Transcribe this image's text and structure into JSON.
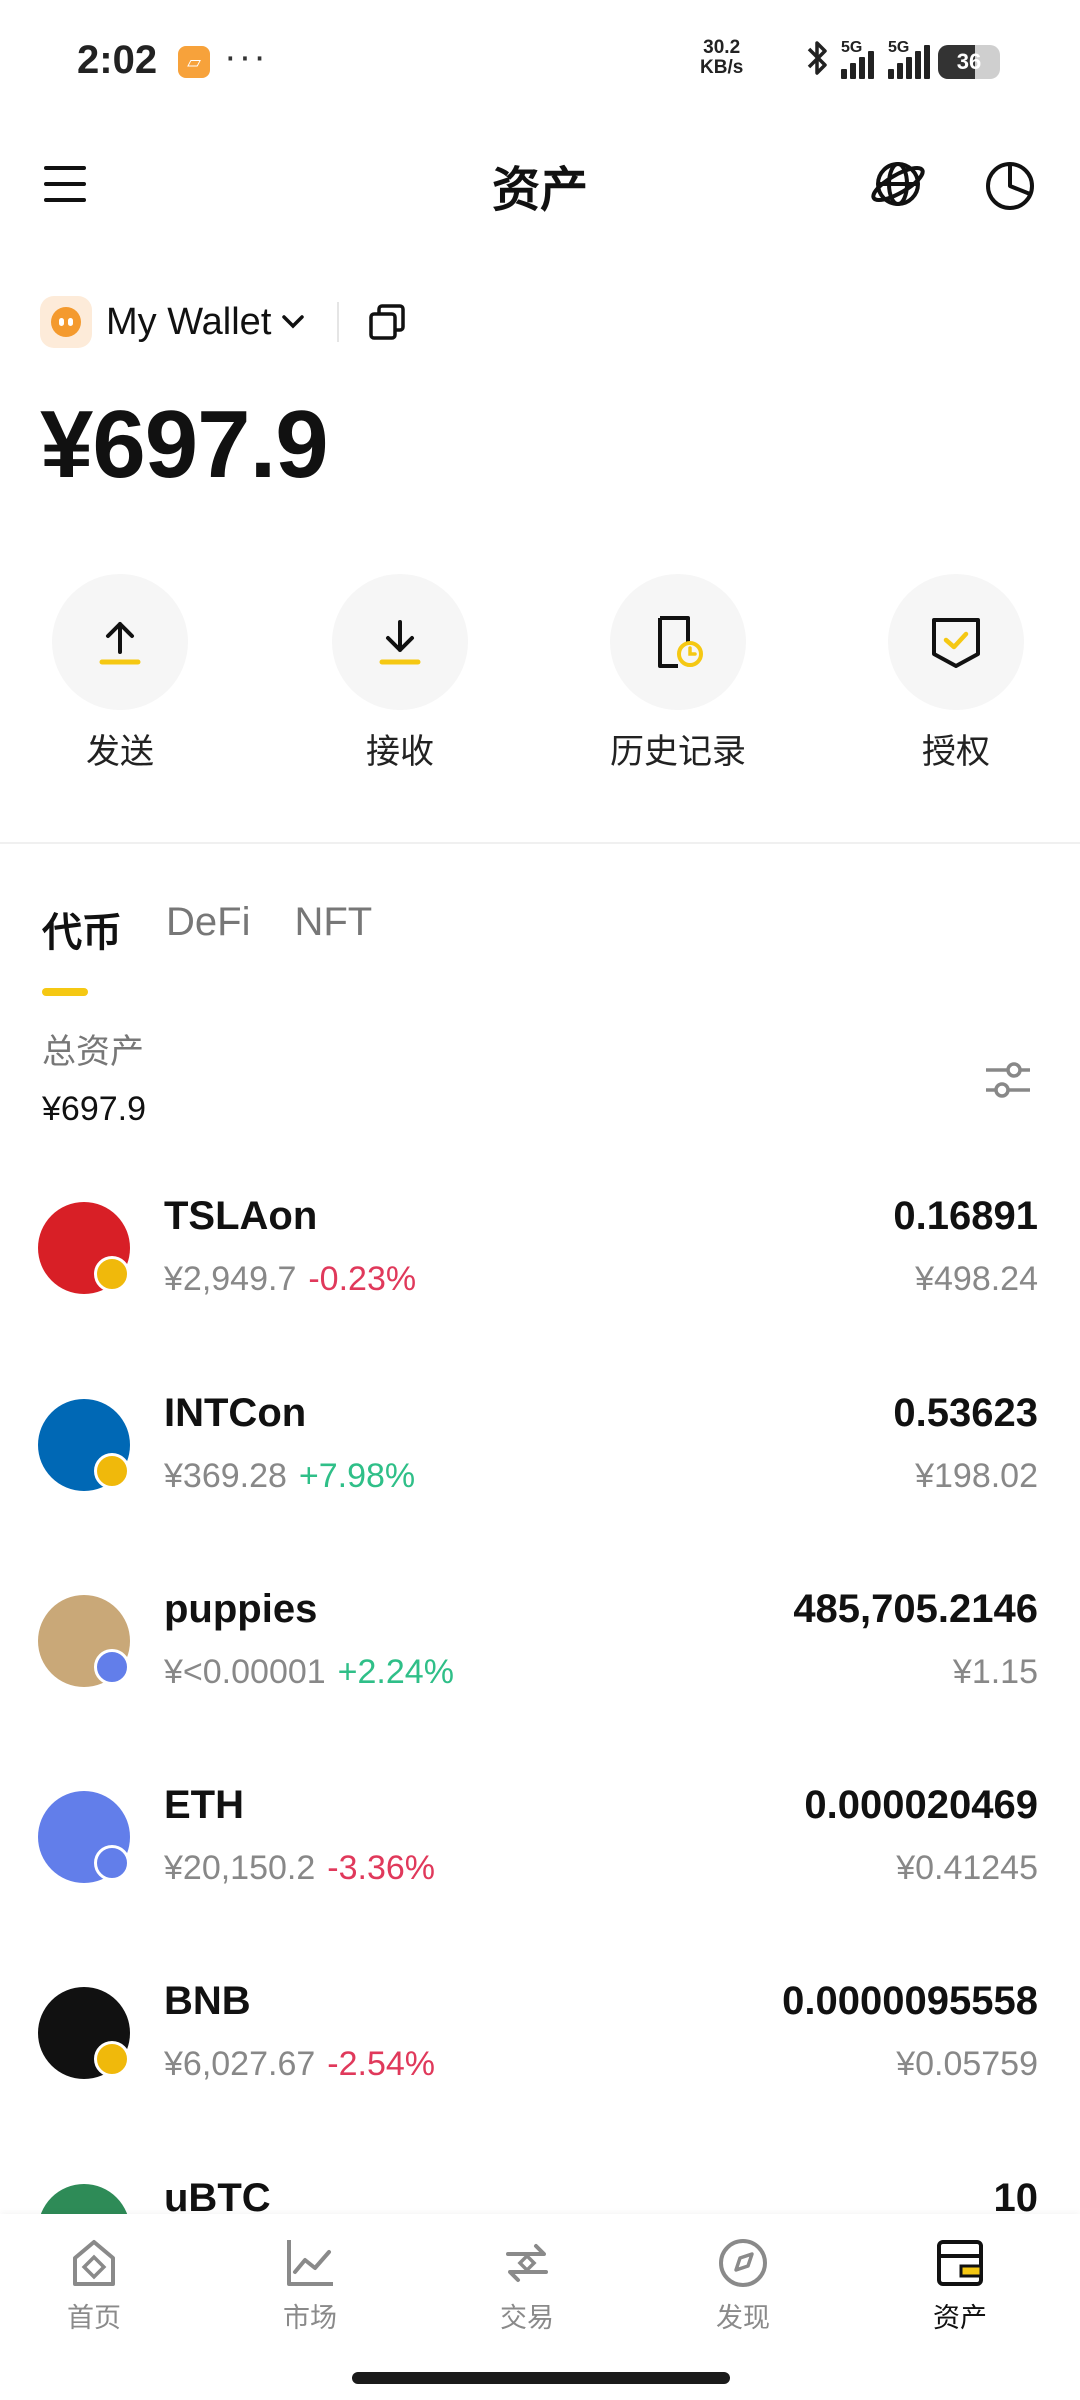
{
  "status_bar": {
    "time": "2:02",
    "dots": "···",
    "net_speed_value": "30.2",
    "net_speed_unit": "KB/s",
    "signal1_label": "5G",
    "signal2_label": "5G",
    "battery": "36"
  },
  "header": {
    "title": "资产"
  },
  "wallet": {
    "name": "My Wallet",
    "balance": "¥697.9"
  },
  "actions": [
    {
      "label": "发送"
    },
    {
      "label": "接收"
    },
    {
      "label": "历史记录"
    },
    {
      "label": "授权"
    }
  ],
  "tabs": [
    {
      "label": "代币",
      "active": true
    },
    {
      "label": "DeFi",
      "active": false
    },
    {
      "label": "NFT",
      "active": false
    }
  ],
  "summary": {
    "label": "总资产",
    "value": "¥697.9"
  },
  "tokens": [
    {
      "symbol": "TSLAon",
      "price": "¥2,949.7",
      "change": "-0.23%",
      "amount": "0.16891",
      "value": "¥498.24",
      "logo_color": "#d81f26",
      "badge_color": "#f0b90b"
    },
    {
      "symbol": "INTCon",
      "price": "¥369.28",
      "change": "+7.98%",
      "amount": "0.53623",
      "value": "¥198.02",
      "logo_color": "#0068b5",
      "badge_color": "#f0b90b"
    },
    {
      "symbol": "puppies",
      "price": "¥<0.00001",
      "change": "+2.24%",
      "amount": "485,705.2146",
      "value": "¥1.15",
      "logo_color": "#c9a878",
      "badge_color": "#627eea"
    },
    {
      "symbol": "ETH",
      "price": "¥20,150.2",
      "change": "-3.36%",
      "amount": "0.000020469",
      "value": "¥0.41245",
      "logo_color": "#627eea",
      "badge_color": "#627eea"
    },
    {
      "symbol": "BNB",
      "price": "¥6,027.67",
      "change": "-2.54%",
      "amount": "0.0000095558",
      "value": "¥0.05759",
      "logo_color": "#111111",
      "badge_color": "#f0b90b"
    },
    {
      "symbol": "uBTC",
      "price": "",
      "change": "",
      "amount": "10",
      "value": "",
      "logo_color": "#2e8b57",
      "badge_color": "#f0b90b"
    }
  ],
  "bottom_nav": [
    {
      "label": "首页",
      "icon": "home-icon",
      "active": false
    },
    {
      "label": "市场",
      "icon": "chart-icon",
      "active": false
    },
    {
      "label": "交易",
      "icon": "swap-icon",
      "active": false
    },
    {
      "label": "发现",
      "icon": "compass-icon",
      "active": false
    },
    {
      "label": "资产",
      "icon": "wallet-icon",
      "active": true
    }
  ],
  "colors": {
    "accent": "#f5c813",
    "negative": "#e0395b",
    "positive": "#2fbf88"
  }
}
